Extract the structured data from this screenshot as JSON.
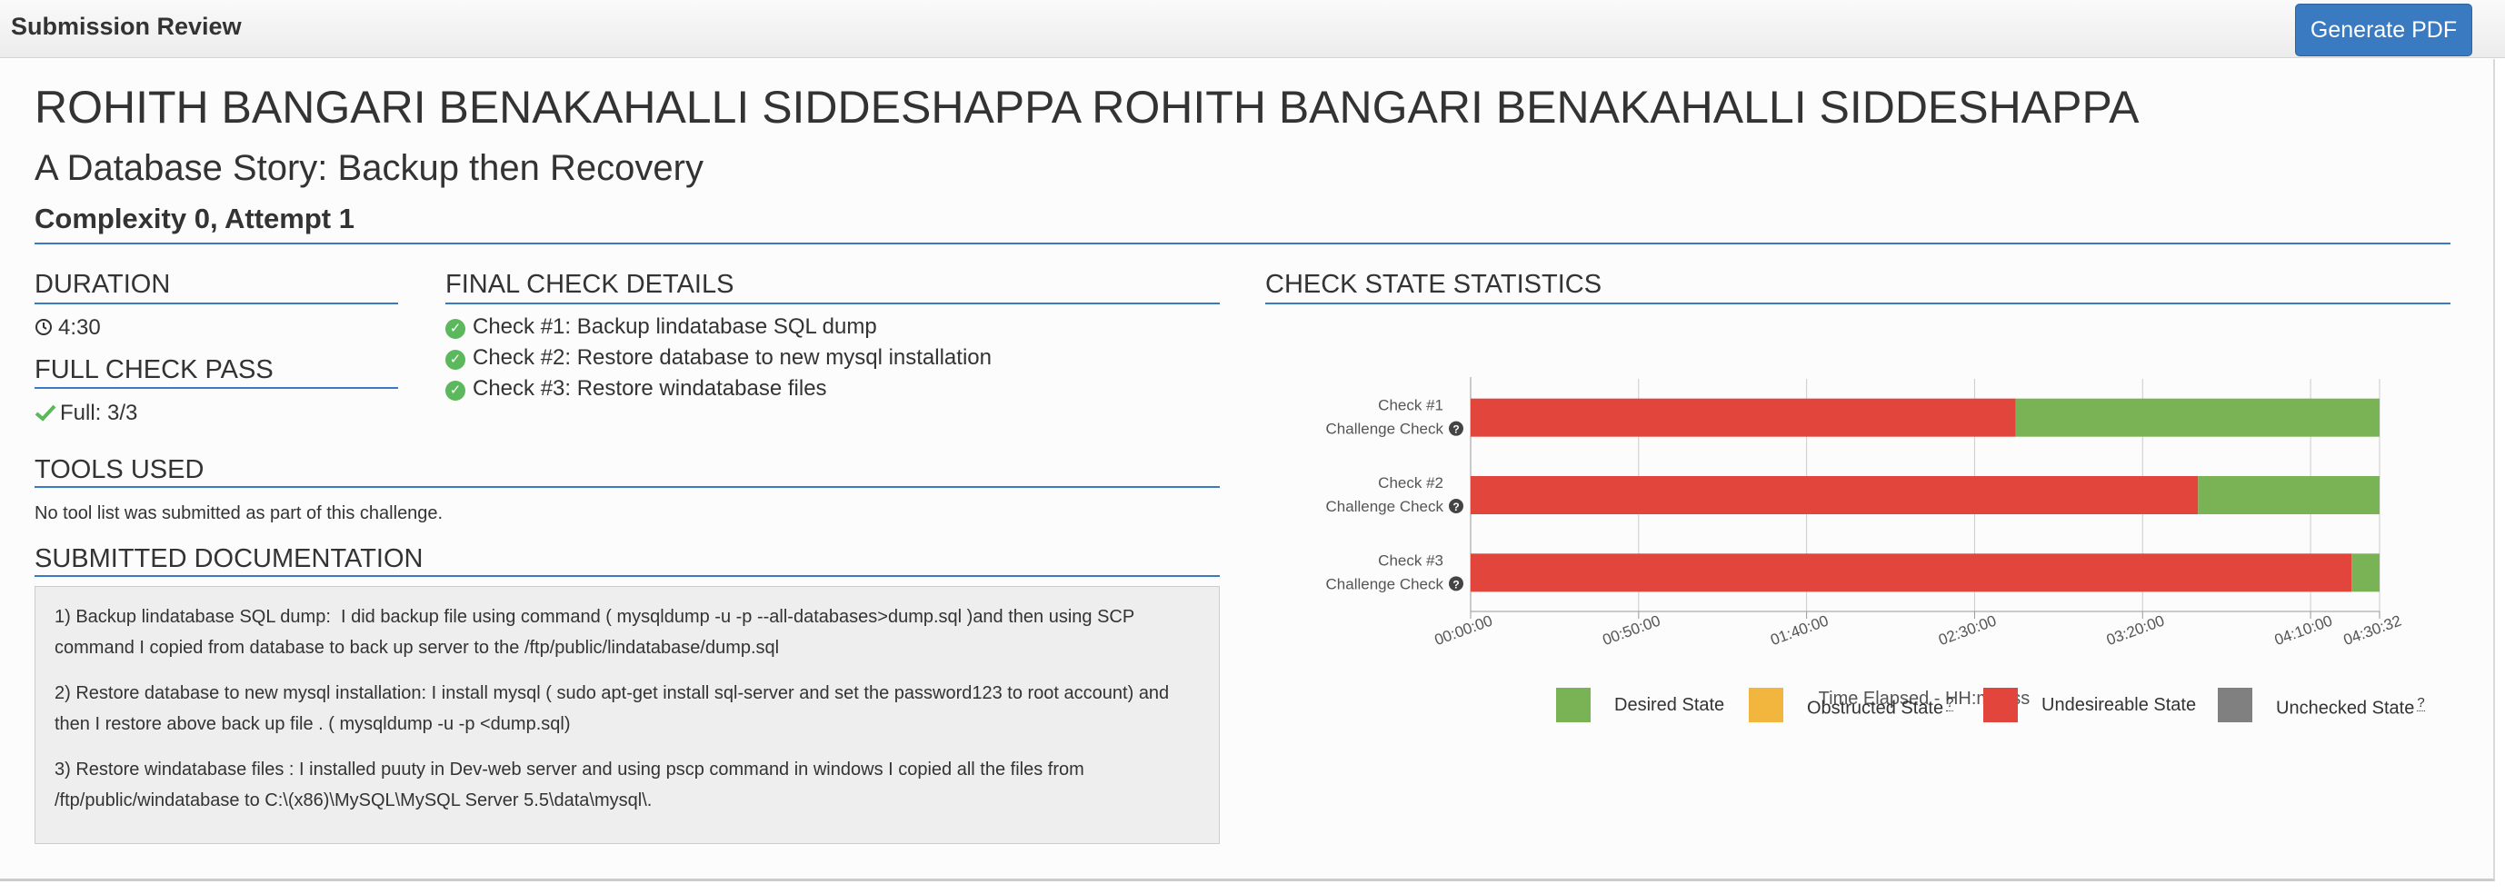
{
  "header": {
    "title": "Submission Review",
    "pdf_button": "Generate PDF"
  },
  "student": {
    "name": "ROHITH BANGARI BENAKAHALLI SIDDESHAPPA ROHITH BANGARI BENAKAHALLI SIDDESHAPPA",
    "challenge": "A Database Story: Backup then Recovery",
    "complexity": "Complexity 0, Attempt 1"
  },
  "duration": {
    "heading": "DURATION",
    "value": "4:30",
    "icon": "clock-icon"
  },
  "full_check": {
    "heading": "FULL CHECK PASS",
    "value": "Full: 3/3",
    "icon": "checkmark-icon"
  },
  "final_checks": {
    "heading": "FINAL CHECK DETAILS",
    "items": [
      "Check #1: Backup lindatabase SQL dump",
      "Check #2: Restore database to new mysql installation",
      "Check #3: Restore windatabase files"
    ]
  },
  "tools": {
    "heading": "TOOLS USED",
    "text": "No tool list was submitted as part of this challenge."
  },
  "documentation": {
    "heading": "SUBMITTED DOCUMENTATION",
    "paragraphs": [
      "1) Backup lindatabase SQL dump:  I did backup file using command ( mysqldump -u -p --all-databases>dump.sql )and then using SCP command I copied from database to back up server to the /ftp/public/lindatabase/dump.sql",
      "2) Restore database to new mysql installation: I install mysql ( sudo apt-get install sql-server and set the password123 to root account) and then I restore above back up file . ( mysqldump -u -p <dump.sql)",
      "3) Restore windatabase files : I installed puuty in Dev-web server and using pscp command in windows I copied all the files from /ftp/public/windatabase to C:\\(x86)\\MySQL\\MySQL Server 5.5\\data\\mysql\\."
    ]
  },
  "stats": {
    "heading": "CHECK STATE STATISTICS"
  },
  "colors": {
    "accent": "#3a7ac0",
    "desired": "#7ab356",
    "obstructed": "#f2b53d",
    "undesirable": "#e2453c",
    "unchecked": "#808080",
    "check_green": "#5cb85c"
  },
  "chart_data": {
    "type": "bar",
    "orientation": "horizontal",
    "stacked": true,
    "xlabel": "Time Elapsed - HH:mm:ss",
    "x_ticks": [
      "00:00:00",
      "00:50:00",
      "01:40:00",
      "02:30:00",
      "03:20:00",
      "04:10:00",
      "04:30:32"
    ],
    "x_tick_seconds": [
      0,
      3000,
      6000,
      9000,
      12000,
      15000,
      16232
    ],
    "xlim": [
      0,
      16232
    ],
    "grid": true,
    "legend_position": "bottom",
    "categories": [
      {
        "line1": "Check #1",
        "line2": "Challenge Check",
        "help_icon": "question-circle-icon"
      },
      {
        "line1": "Check #2",
        "line2": "Challenge Check",
        "help_icon": "question-circle-icon"
      },
      {
        "line1": "Check #3",
        "line2": "Challenge Check",
        "help_icon": "question-circle-icon"
      }
    ],
    "series": [
      {
        "name": "Undesireable State",
        "color": "#e2453c",
        "values": [
          9735,
          12990,
          15730
        ]
      },
      {
        "name": "Desired State",
        "color": "#7ab356",
        "values": [
          6497,
          3242,
          502
        ]
      },
      {
        "name": "Obstructed State",
        "color": "#f2b53d",
        "values": [
          0,
          0,
          0
        ]
      },
      {
        "name": "Unchecked State",
        "color": "#808080",
        "values": [
          0,
          0,
          0
        ]
      }
    ],
    "legend": [
      {
        "name": "Desired State",
        "color": "#7ab356",
        "help": false
      },
      {
        "name": "Obstructed State",
        "color": "#f2b53d",
        "help": true
      },
      {
        "name": "Undesireable State",
        "color": "#e2453c",
        "help": false
      },
      {
        "name": "Unchecked State",
        "color": "#808080",
        "help": true
      }
    ],
    "help_marker": "?"
  }
}
